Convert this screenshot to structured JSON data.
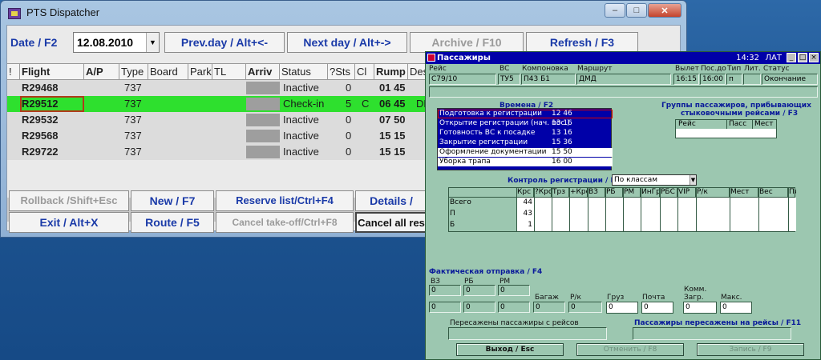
{
  "dispatcher": {
    "title": "PTS Dispatcher",
    "toolbar": {
      "date_label": "Date / F2",
      "date_value": "12.08.2010",
      "prev_day": "Prev.day / Alt+<-",
      "next_day": "Next day / Alt+->",
      "archive": "Archive / F10",
      "refresh": "Refresh / F3"
    },
    "columns": [
      "!",
      "Flight",
      "A/P",
      "Type",
      "Board",
      "Park",
      "TL",
      "Arriv",
      "Status",
      "?Sts",
      "Cl",
      "Rump",
      "Des"
    ],
    "rows": [
      {
        "flight": "R29468",
        "type": "737",
        "status": "Inactive",
        "sts": "0",
        "cl": "",
        "rump": "01 45",
        "des": ""
      },
      {
        "flight": "R29512",
        "type": "737",
        "status": "Check-in",
        "sts": "5",
        "cl": "C",
        "rump": "06 45",
        "des": "DE"
      },
      {
        "flight": "R29532",
        "type": "737",
        "status": "Inactive",
        "sts": "0",
        "cl": "",
        "rump": "07 50",
        "des": ""
      },
      {
        "flight": "R29568",
        "type": "737",
        "status": "Inactive",
        "sts": "0",
        "cl": "",
        "rump": "15 15",
        "des": ""
      },
      {
        "flight": "R29722",
        "type": "737",
        "status": "Inactive",
        "sts": "0",
        "cl": "",
        "rump": "15 15",
        "des": ""
      }
    ],
    "buttons": {
      "rollback": "Rollback /Shift+Esc",
      "new": "New / F7",
      "reserve": "Reserve list/Ctrl+F4",
      "details": "Details /",
      "exit": "Exit / Alt+X",
      "route": "Route / F5",
      "cancel_takeoff": "Cancel take-off/Ctrl+F8",
      "cancel_all": "Cancel all res"
    }
  },
  "passengers": {
    "title": "Пассажиры",
    "clock": "14:32",
    "lang": "ЛАТ",
    "flight_header": {
      "labels": [
        "Рейс",
        "ВС",
        "Компоновка",
        "Маршрут",
        "Вылет",
        "Пос.до",
        "Тип",
        "Лит.",
        "Статус"
      ],
      "values": [
        "С79/10",
        "ТУ5",
        "П43 Б1",
        "ДМД",
        "16:15",
        "16:00",
        "п",
        "",
        "Окончание"
      ]
    },
    "times_title": "Времена / F2",
    "times": [
      {
        "name": "Подготовка к регистрации",
        "value": "12 46"
      },
      {
        "name": "Открытие регистрации (нач. пос.)",
        "value": "13 16"
      },
      {
        "name": "Готовность ВС к посадке",
        "value": "13 16"
      },
      {
        "name": "Закрытие регистрации",
        "value": "15 36"
      },
      {
        "name": "Оформление документации",
        "value": "15 50"
      },
      {
        "name": "Уборка трапа",
        "value": "16 00"
      }
    ],
    "groups_title_1": "Группы пассажиров, прибывающих",
    "groups_title_2": "стыковочными рейсами / F3",
    "groups_cols": [
      "Рейс",
      "Пасс",
      "Мест"
    ],
    "control_title": "Контроль регистрации / F5",
    "control_mode": "По классам",
    "control_cols": [
      "Крс",
      "?Крс",
      "Трз",
      "+Крс",
      "ВЗ",
      "РБ",
      "РМ",
      "ИнГр",
      "РБС",
      "VIP",
      "Р/к",
      "Мест",
      "Вес",
      "Плат"
    ],
    "control_rows": [
      {
        "label": "Всего",
        "krs": "44"
      },
      {
        "label": "П",
        "krs": "43"
      },
      {
        "label": "Б",
        "krs": "1"
      }
    ],
    "actual_title": "Фактическая отправка / F4",
    "actual_fields": {
      "vz": {
        "label": "ВЗ",
        "v1": "0",
        "v2": "0"
      },
      "rb": {
        "label": "РБ",
        "v1": "0",
        "v2": "0"
      },
      "rm": {
        "label": "РМ",
        "v1": "0",
        "v2": "0"
      },
      "bagazh": {
        "label": "Багаж",
        "v": "0"
      },
      "rk": {
        "label": "Р/к",
        "v": "0"
      },
      "gruz": {
        "label": "Груз",
        "v": "0"
      },
      "pochta": {
        "label": "Почта",
        "v": "0"
      },
      "komm_1": "Комм.",
      "komm_2": "Загр.",
      "komm_v": "0",
      "maks": {
        "label": "Макс.",
        "v": "0"
      }
    },
    "transferred_from": "Пересажены пассажиры с рейсов",
    "transferred_to": "Пассажиры пересажены на рейсы / F11",
    "buttons": {
      "exit": "Выход / Esc",
      "cancel": "Отменить / F8",
      "save": "Запись / F9"
    }
  }
}
